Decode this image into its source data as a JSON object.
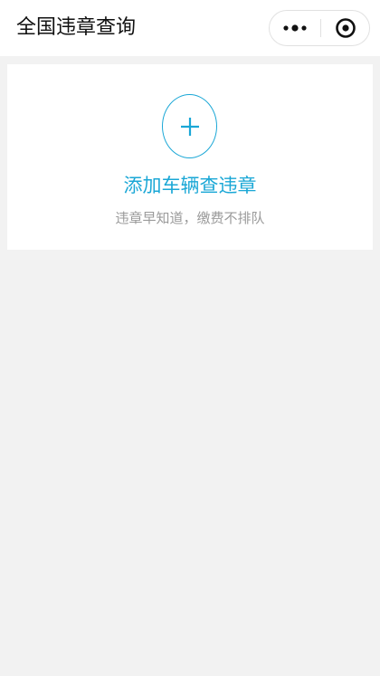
{
  "header": {
    "title": "全国违章查询",
    "menu_icon": "more-dots-icon",
    "close_icon": "mini-program-close-icon"
  },
  "add_vehicle_card": {
    "icon": "plus-icon",
    "label": "添加车辆查违章",
    "subtitle": "违章早知道，缴费不排队"
  },
  "colors": {
    "accent": "#1aa7d6",
    "background": "#f2f2f2",
    "card": "#ffffff",
    "subtitle": "#9a9a9a"
  }
}
